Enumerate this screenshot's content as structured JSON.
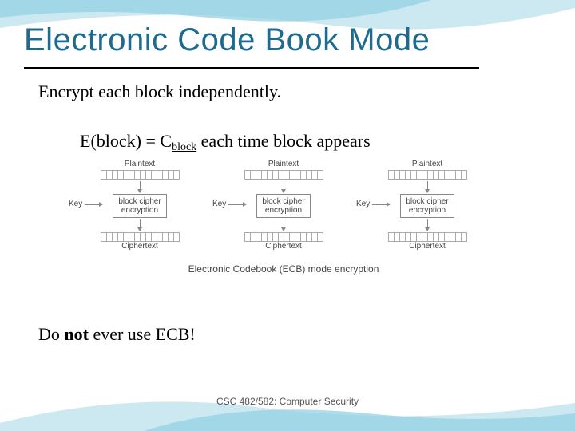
{
  "title": "Electronic Code Book Mode",
  "line1": "Encrypt each block independently.",
  "formula": {
    "lhs": "E(block) = C",
    "sub": "block",
    "rhs": " each time block appears"
  },
  "diagram": {
    "plaintext_label": "Plaintext",
    "ciphertext_label": "Ciphertext",
    "key_label": "Key",
    "box_line1": "block cipher",
    "box_line2": "encryption",
    "caption": "Electronic Codebook (ECB) mode encryption"
  },
  "line3_pre": "Do ",
  "line3_strong": "not",
  "line3_post": " ever use ECB!",
  "footer": "CSC 482/582: Computer Security"
}
